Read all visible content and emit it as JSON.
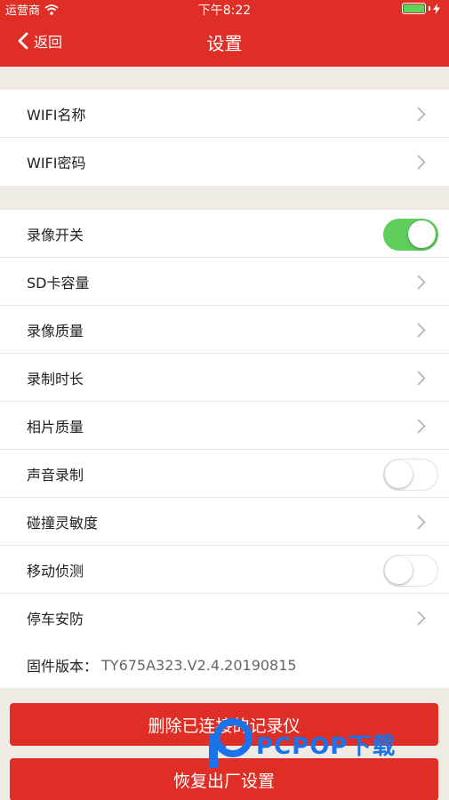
{
  "status_bar": {
    "carrier": "运营商",
    "time": "下午8:22",
    "battery_level": 1.0
  },
  "nav": {
    "back_label": "返回",
    "title": "设置"
  },
  "group1": [
    {
      "label": "WIFI名称",
      "control": "chevron"
    },
    {
      "label": "WIFI密码",
      "control": "chevron"
    }
  ],
  "group2": [
    {
      "label": "录像开关",
      "control": "toggle",
      "state": "on"
    },
    {
      "label": "SD卡容量",
      "control": "chevron"
    },
    {
      "label": "录像质量",
      "control": "chevron"
    },
    {
      "label": "录制时长",
      "control": "chevron"
    },
    {
      "label": "相片质量",
      "control": "chevron"
    },
    {
      "label": "声音录制",
      "control": "toggle",
      "state": "off"
    },
    {
      "label": "碰撞灵敏度",
      "control": "chevron"
    },
    {
      "label": "移动侦测",
      "control": "toggle",
      "state": "off"
    },
    {
      "label": "停车安防",
      "control": "chevron"
    }
  ],
  "firmware": {
    "label": "固件版本：",
    "value": "TY675A323.V2.4.20190815"
  },
  "buttons": {
    "delete_label": "删除已连接的记录仪",
    "reset_label": "恢复出厂设置"
  },
  "watermark": {
    "text": "PCPOP下载"
  },
  "colors": {
    "brand_red": "#df2e25",
    "toggle_on": "#5fce5d",
    "background": "#efebe4"
  }
}
